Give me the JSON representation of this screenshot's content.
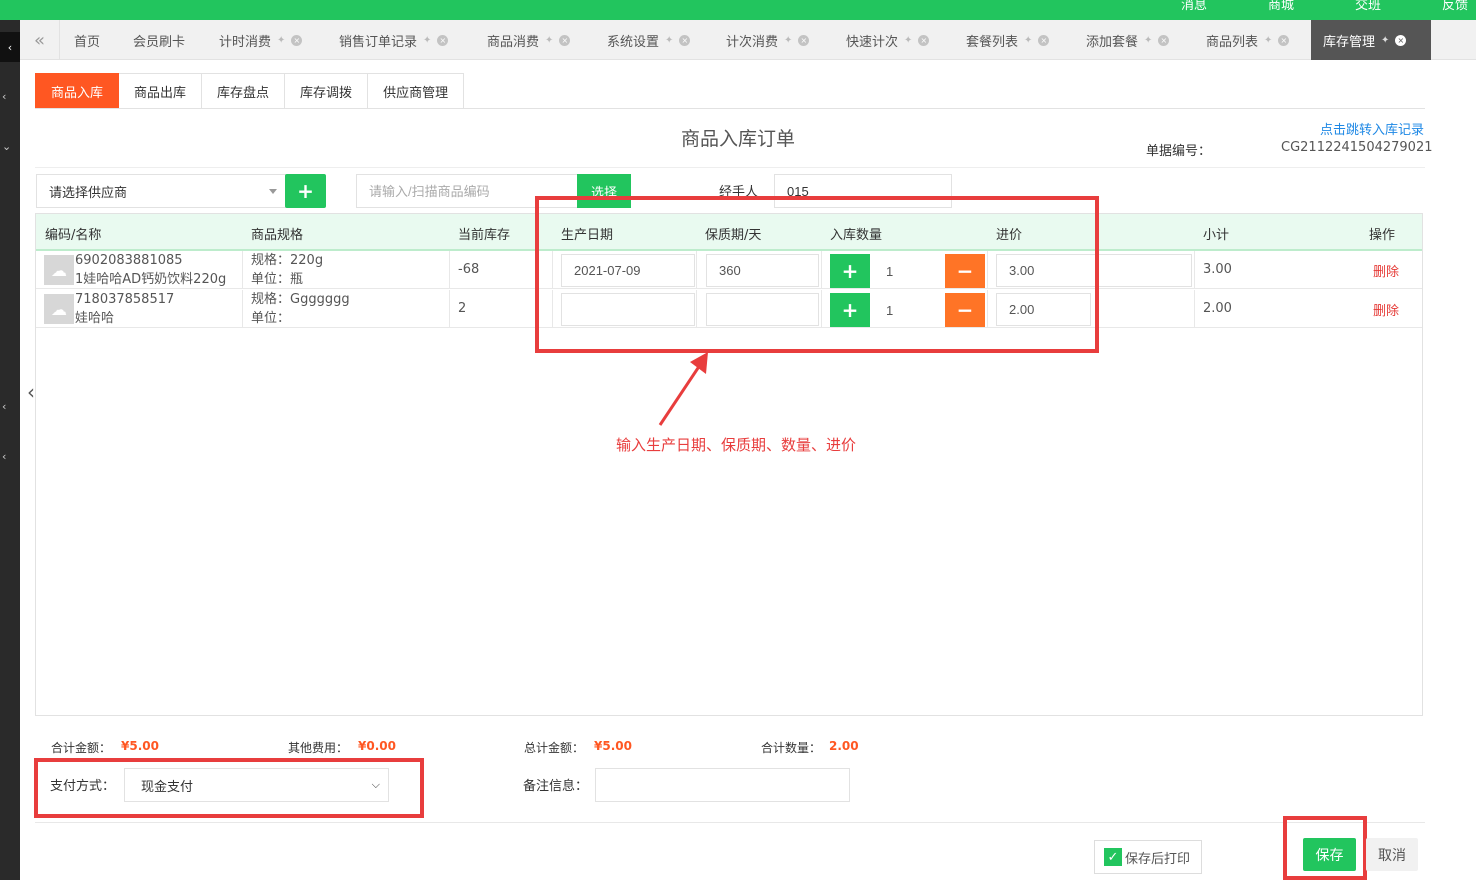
{
  "topnav": [
    "消息",
    "商城",
    "交班",
    "反馈"
  ],
  "tabs": [
    {
      "label": "首页"
    },
    {
      "label": "会员刷卡"
    },
    {
      "label": "计时消费"
    },
    {
      "label": "销售订单记录"
    },
    {
      "label": "商品消费"
    },
    {
      "label": "系统设置"
    },
    {
      "label": "计次消费"
    },
    {
      "label": "快速计次"
    },
    {
      "label": "套餐列表"
    },
    {
      "label": "添加套餐"
    },
    {
      "label": "商品列表"
    },
    {
      "label": "库存管理"
    }
  ],
  "active_tab": "库存管理",
  "subtabs": [
    "商品入库",
    "商品出库",
    "库存盘点",
    "库存调拨",
    "供应商管理"
  ],
  "active_subtab": "商品入库",
  "order": {
    "title": "商品入库订单",
    "record_link": "点击跳转入库记录",
    "no_label": "单据编号：",
    "no_value": "CG2112241504279021"
  },
  "toolbar": {
    "supplier_placeholder": "请选择供应商",
    "code_placeholder": "请输入/扫描商品编码",
    "select_btn": "选择",
    "handler_label": "经手人",
    "handler_value": "015"
  },
  "table": {
    "headers": [
      "编码/名称",
      "商品规格",
      "当前库存",
      "生产日期",
      "保质期/天",
      "入库数量",
      "进价",
      "小计",
      "操作"
    ],
    "rows": [
      {
        "code": "6902083881085",
        "name": "1娃哈哈AD钙奶饮料220g",
        "spec": "规格：220g",
        "unit": "单位：瓶",
        "stock": "-68",
        "prod_date": "2021-07-09",
        "shelf_life": "360",
        "qty": "1",
        "price": "3.00",
        "subtotal": "3.00",
        "action": "删除"
      },
      {
        "code": "718037858517",
        "name": "娃哈哈",
        "spec": "规格：Ggggggg",
        "unit": "单位：",
        "stock": "2",
        "prod_date": "",
        "shelf_life": "",
        "qty": "1",
        "price": "2.00",
        "subtotal": "2.00",
        "action": "删除"
      }
    ]
  },
  "annotation": "输入生产日期、保质期、数量、进价",
  "summary": {
    "total_label": "合计金额：",
    "total_value": "¥5.00",
    "other_label": "其他费用：",
    "other_value": "¥0.00",
    "grand_label": "总计金额：",
    "grand_value": "¥5.00",
    "count_label": "合计数量：",
    "count_value": "2.00"
  },
  "payment": {
    "label": "支付方式：",
    "value": "现金支付"
  },
  "remark_label": "备注信息：",
  "actions": {
    "print_label": "保存后打印",
    "save": "保存",
    "cancel": "取消"
  },
  "colors": {
    "green": "#22c55e",
    "orange": "#ff5722",
    "annotation_red": "#e83d3d"
  }
}
